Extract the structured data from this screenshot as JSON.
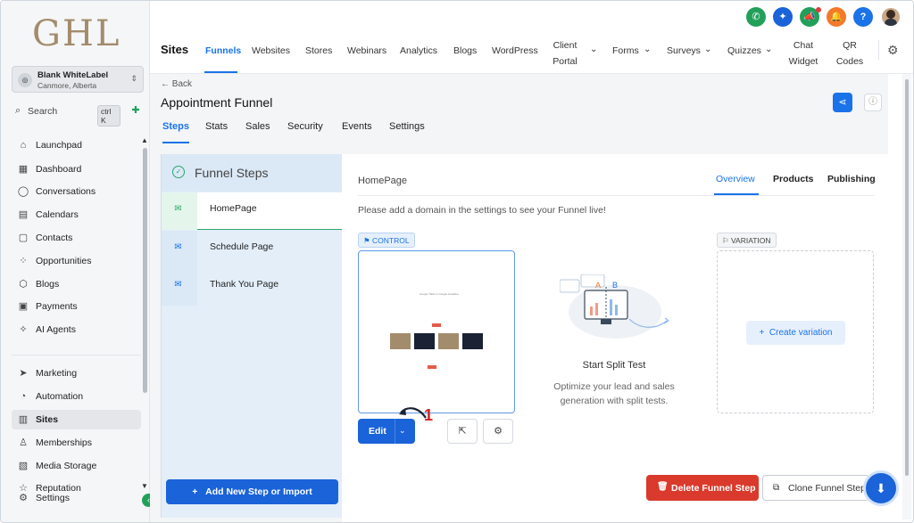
{
  "sidebar": {
    "logo": "GHL",
    "account": {
      "name": "Blank WhiteLabel",
      "location": "Canmore, Alberta"
    },
    "search": {
      "label": "Search",
      "shortcut": "ctrl K"
    },
    "items": [
      {
        "label": "Launchpad",
        "icon": "⌂"
      },
      {
        "label": "Dashboard",
        "icon": "▦"
      },
      {
        "label": "Conversations",
        "icon": "◯"
      },
      {
        "label": "Calendars",
        "icon": "▤"
      },
      {
        "label": "Contacts",
        "icon": "▢"
      },
      {
        "label": "Opportunities",
        "icon": "⁘"
      },
      {
        "label": "Blogs",
        "icon": "⬡"
      },
      {
        "label": "Payments",
        "icon": "▣"
      },
      {
        "label": "AI Agents",
        "icon": "✧"
      }
    ],
    "items2": [
      {
        "label": "Marketing",
        "icon": "➤"
      },
      {
        "label": "Automation",
        "icon": "◔"
      },
      {
        "label": "Sites",
        "icon": "▥"
      },
      {
        "label": "Memberships",
        "icon": "♙"
      },
      {
        "label": "Media Storage",
        "icon": "▧"
      },
      {
        "label": "Reputation",
        "icon": "☆"
      },
      {
        "label": "Settings",
        "icon": "⚙"
      }
    ]
  },
  "topbar": {
    "section": "Sites",
    "nav": [
      "Funnels",
      "Websites",
      "Stores",
      "Webinars",
      "Analytics",
      "Blogs",
      "WordPress",
      "Client Portal",
      "Forms",
      "Surveys",
      "Quizzes",
      "Chat Widget",
      "QR Codes"
    ],
    "icons": [
      {
        "name": "phone",
        "color": "#22a05a",
        "glyph": "✆"
      },
      {
        "name": "magic",
        "color": "#1a63d8",
        "glyph": "✦"
      },
      {
        "name": "megaphone",
        "color": "#22a05a",
        "glyph": "📣"
      },
      {
        "name": "bell",
        "color": "#f37a2a",
        "glyph": "🔔"
      },
      {
        "name": "help",
        "color": "#1a73e8",
        "glyph": "?"
      }
    ]
  },
  "funnel": {
    "back": "← Back",
    "title": "Appointment Funnel",
    "tabs": [
      "Steps",
      "Stats",
      "Sales",
      "Security",
      "Events",
      "Settings"
    ]
  },
  "steps": {
    "header": "Funnel Steps",
    "list": [
      "HomePage",
      "Schedule Page",
      "Thank You Page"
    ],
    "add_button": "Add New Step or Import"
  },
  "detail": {
    "page_name": "HomePage",
    "tabs": [
      "Overview",
      "Products",
      "Publishing"
    ],
    "notice": "Please add a domain in the settings to see your Funnel live!",
    "control_badge": "CONTROL",
    "variation_badge": "VARIATION",
    "edit_label": "Edit",
    "annotation": "1",
    "split_title": "Start Split Test",
    "split_desc": "Optimize your lead and sales generation with split tests.",
    "create_variation": "Create variation",
    "delete_label": "Delete Funnel Step",
    "clone_label": "Clone Funnel Step",
    "preview_title": "Google Table in Google Headline"
  },
  "colors": {
    "primary": "#1a63d8",
    "accent_blue": "#1a73e8",
    "success": "#22a05a",
    "danger": "#d93a2b"
  }
}
